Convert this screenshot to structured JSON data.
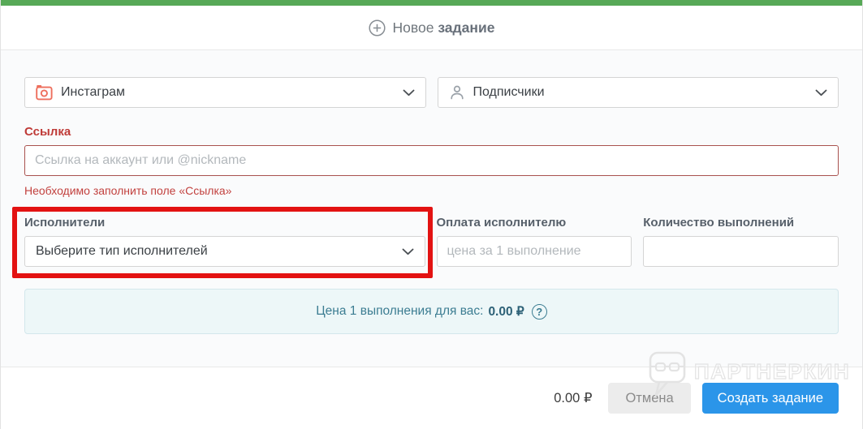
{
  "header": {
    "title_prefix": "Новое",
    "title_emphasis": "задание"
  },
  "form": {
    "network_select": {
      "value": "Инстаграм",
      "icon": "camera-icon"
    },
    "service_select": {
      "value": "Подписчики",
      "icon": "person-icon"
    },
    "link": {
      "label": "Ссылка",
      "value": "",
      "placeholder": "Ссылка на аккаунт или @nickname",
      "error": "Необходимо заполнить поле «Ссылка»"
    },
    "executors": {
      "label": "Исполнители",
      "value": "Выберите тип исполнителей"
    },
    "payment": {
      "label": "Оплата исполнителю",
      "value": "",
      "placeholder": "цена за 1 выполнение"
    },
    "quantity": {
      "label": "Количество выполнений",
      "value": ""
    },
    "info": {
      "text": "Цена 1 выполнения для вас:",
      "value": "0.00 ₽",
      "help_icon": "?"
    }
  },
  "footer": {
    "total": "0.00 ₽",
    "cancel_label": "Отмена",
    "submit_label": "Создать задание"
  },
  "watermark": {
    "text": "ПАРТНЕРКИН"
  },
  "colors": {
    "top_accent_green": "#57a957",
    "highlight_red": "#e31212",
    "error_red": "#c2413e",
    "label_red": "#bf3b38",
    "info_teal": "#3c7d92",
    "info_bg": "#edf7f8",
    "submit_blue": "#2b95e9",
    "instagram_icon": "#ee6f5d"
  }
}
